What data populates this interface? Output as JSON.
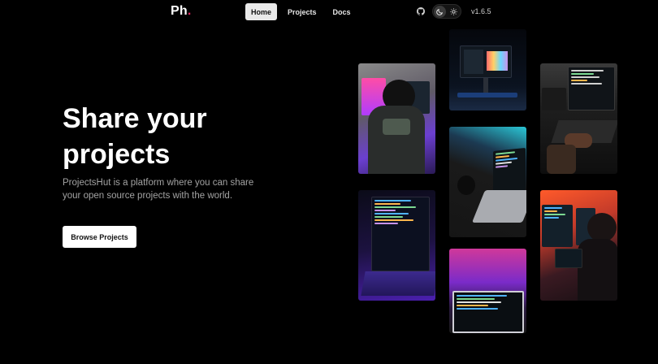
{
  "nav": {
    "logo_text": "Ph",
    "logo_dot": ".",
    "links": [
      {
        "label": "Home"
      },
      {
        "label": "Projects"
      },
      {
        "label": "Docs"
      }
    ],
    "version": "v1.6.5",
    "icons": [
      "github-icon",
      "moon-icon",
      "sun-icon"
    ]
  },
  "hero": {
    "title": "Share your projects",
    "subtitle": "ProjectsHut is a platform where you can share your open source projects with the world.",
    "cta_label": "Browse Projects"
  },
  "colors": {
    "background": "#000000",
    "accent_dot": "#e0245e",
    "subtitle": "#a3a3a3"
  },
  "gallery": {
    "images": [
      "developer-at-desk-photo",
      "monitor-on-dark-desk-photo",
      "developer-typing-photo",
      "laptop-with-code-photo",
      "purple-laptop-photo",
      "red-lit-workspace-photo",
      "neon-laptop-photo"
    ]
  }
}
